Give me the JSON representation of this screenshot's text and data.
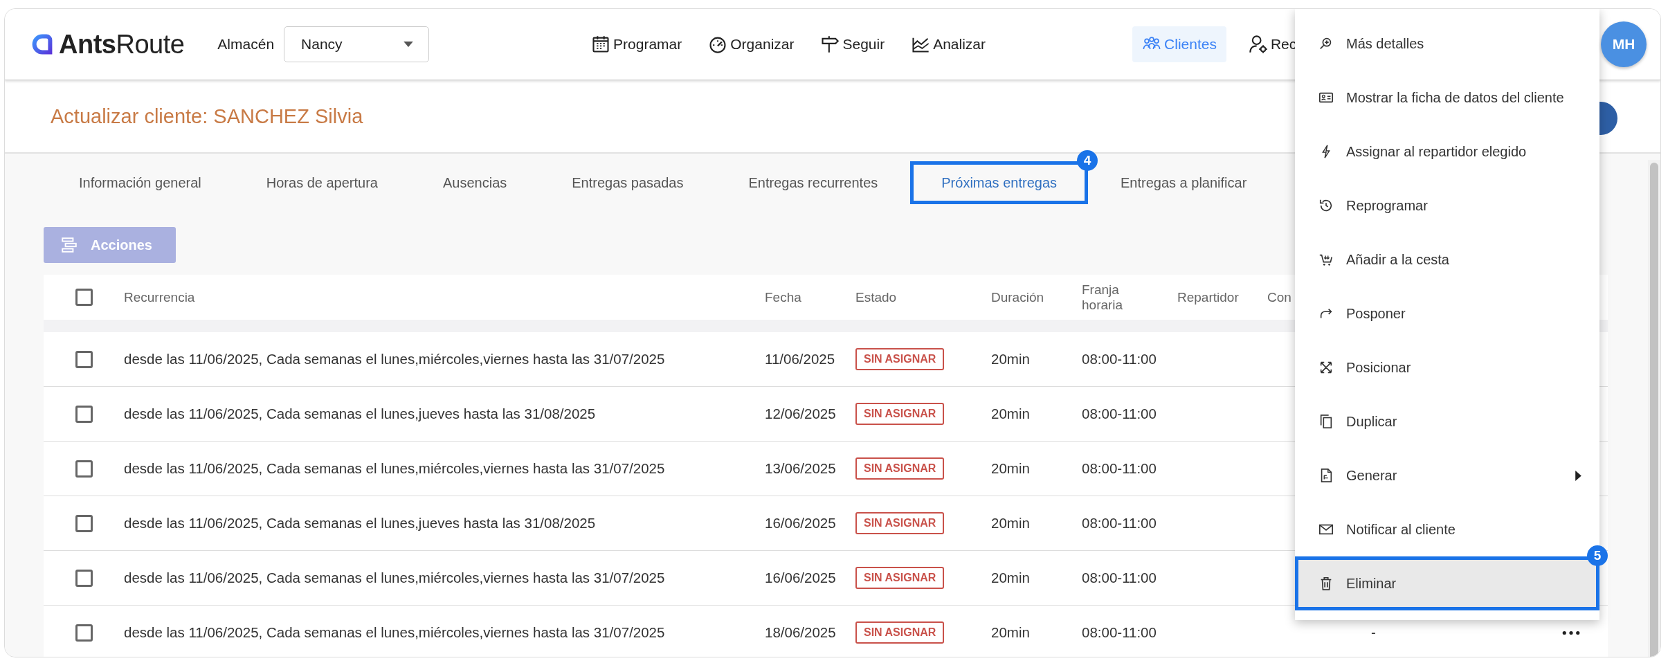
{
  "topbar": {
    "logo": "**Ants**Route",
    "warehouse_label": "Almacén",
    "warehouse": {
      "value": "Nancy"
    },
    "nav": [
      {
        "label": "Programar",
        "selected": false
      },
      {
        "label": "Organizar",
        "selected": false
      },
      {
        "label": "Seguir",
        "selected": false
      },
      {
        "label": "Analizar",
        "selected": false
      },
      {
        "label": "Clientes",
        "selected": true
      },
      {
        "label": "Rec",
        "selected": false
      }
    ],
    "avatar": "MH"
  },
  "page_title": "Actualizar cliente: SANCHEZ Silvia",
  "tabs": [
    {
      "label": "Información general",
      "selected": false
    },
    {
      "label": "Horas de apertura",
      "selected": false
    },
    {
      "label": "Ausencias",
      "selected": false
    },
    {
      "label": "Entregas pasadas",
      "selected": false
    },
    {
      "label": "Entregas recurrentes",
      "selected": false
    },
    {
      "label": "Próximas entregas",
      "selected": true,
      "callout": "4"
    },
    {
      "label": "Entregas a planificar",
      "selected": false
    }
  ],
  "actions_button": "Acciones",
  "table": {
    "select_all_checked": false,
    "columns": [
      "Recurrencia",
      "Fecha",
      "Estado",
      "Duración",
      "Franja horaria",
      "Repartidor",
      "Con"
    ],
    "rows": [
      {
        "checked": false,
        "recurrencia": "desde las 11/06/2025, Cada semanas el lunes,miércoles,viernes hasta las 31/07/2025",
        "fecha": "11/06/2025",
        "estado": {
          "label": "SIN ASIGNAR",
          "kind": "unassigned"
        },
        "duracion": "20min",
        "franja": "08:00-11:00"
      },
      {
        "checked": false,
        "recurrencia": "desde las 11/06/2025, Cada semanas el lunes,jueves hasta las 31/08/2025",
        "fecha": "12/06/2025",
        "estado": {
          "label": "SIN ASIGNAR",
          "kind": "unassigned"
        },
        "duracion": "20min",
        "franja": "08:00-11:00"
      },
      {
        "checked": false,
        "recurrencia": "desde las 11/06/2025, Cada semanas el lunes,miércoles,viernes hasta las 31/07/2025",
        "fecha": "13/06/2025",
        "estado": {
          "label": "SIN ASIGNAR",
          "kind": "unassigned"
        },
        "duracion": "20min",
        "franja": "08:00-11:00"
      },
      {
        "checked": false,
        "recurrencia": "desde las 11/06/2025, Cada semanas el lunes,jueves hasta las 31/08/2025",
        "fecha": "16/06/2025",
        "estado": {
          "label": "SIN ASIGNAR",
          "kind": "unassigned"
        },
        "duracion": "20min",
        "franja": "08:00-11:00"
      },
      {
        "checked": false,
        "recurrencia": "desde las 11/06/2025, Cada semanas el lunes,miércoles,viernes hasta las 31/07/2025",
        "fecha": "16/06/2025",
        "estado": {
          "label": "SIN ASIGNAR",
          "kind": "unassigned"
        },
        "duracion": "20min",
        "franja": "08:00-11:00"
      },
      {
        "checked": false,
        "recurrencia": "desde las 11/06/2025, Cada semanas el lunes,miércoles,viernes hasta las 31/07/2025",
        "fecha": "18/06/2025",
        "estado": {
          "label": "SIN ASIGNAR",
          "kind": "unassigned"
        },
        "duracion": "20min",
        "franja": "08:00-11:00",
        "column_9": "-",
        "more_menu": true
      }
    ]
  },
  "context_menu": [
    {
      "label": "Más detalles",
      "highlighted": false
    },
    {
      "label": "Mostrar la ficha de datos del cliente",
      "highlighted": false
    },
    {
      "label": "Assignar al repartidor elegido",
      "highlighted": false
    },
    {
      "label": "Reprogramar",
      "highlighted": false
    },
    {
      "label": "Añadir a la cesta",
      "highlighted": false
    },
    {
      "label": "Posponer",
      "highlighted": false
    },
    {
      "label": "Posicionar",
      "highlighted": false
    },
    {
      "label": "Duplicar",
      "highlighted": false
    },
    {
      "label": "Generar",
      "highlighted": false,
      "submenu": true
    },
    {
      "label": "Notificar al cliente",
      "highlighted": false
    },
    {
      "label": "Eliminar",
      "highlighted": true,
      "callout": "5"
    }
  ]
}
